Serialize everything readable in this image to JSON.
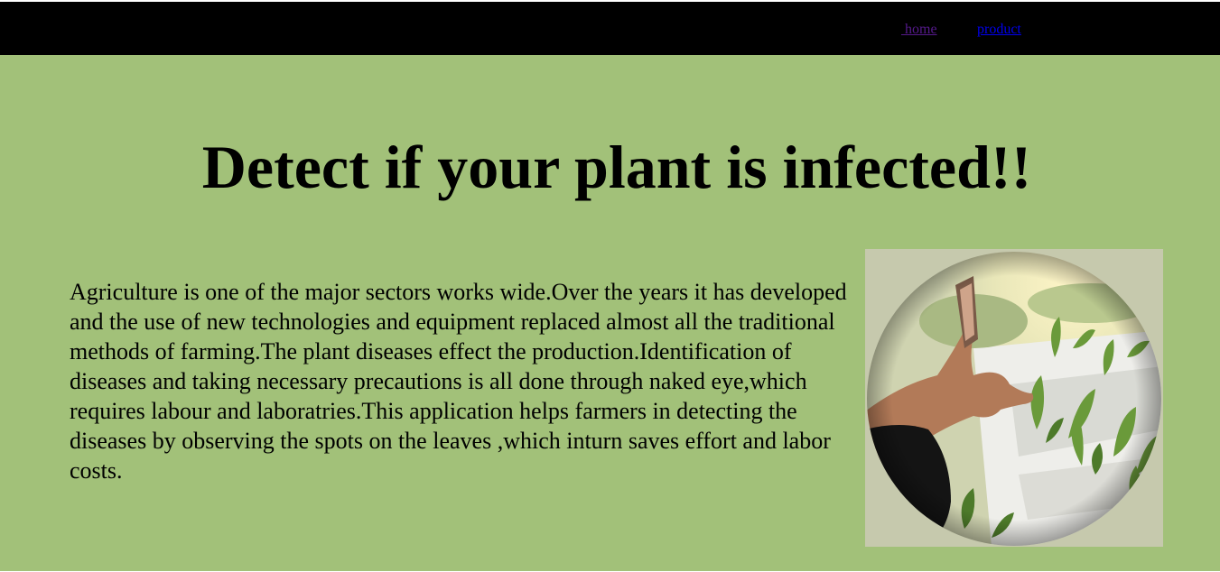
{
  "nav": {
    "home_label": " home",
    "product_label": "product"
  },
  "hero": {
    "title": "Detect if your plant is infected!!",
    "description": "Agriculture is one of the major sectors works wide.Over the years it has developed and the use of new technologies and equipment replaced almost all the traditional methods of farming.The plant diseases effect the production.Identification of diseases and taking necessary precautions is all done through naked eye,which requires labour and laboratries.This application helps farmers in detecting the diseases by observing the spots on the leaves ,which inturn saves effort and labor costs."
  },
  "colors": {
    "navbar_bg": "#000000",
    "hero_bg": "#a2c179",
    "visited_link": "#551a8b",
    "link": "#0000ee"
  }
}
